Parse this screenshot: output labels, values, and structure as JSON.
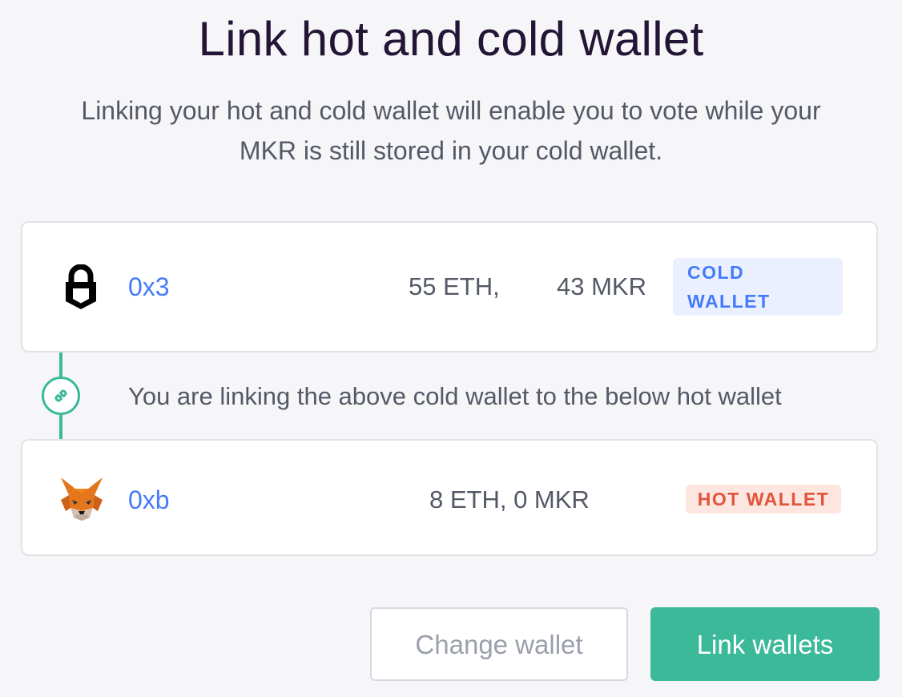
{
  "header": {
    "title": "Link hot and cold wallet",
    "subtitle_line1": "Linking your hot and cold wallet will enable you to vote while your",
    "subtitle_line2": "MKR is still stored in your cold wallet."
  },
  "cold_wallet": {
    "icon": "lock-icon",
    "address": "0x3",
    "eth_balance": "55 ETH,",
    "mkr_balance": "43 MKR",
    "badge_line1": "COLD",
    "badge_line2": "WALLET"
  },
  "connector": {
    "icon": "link-icon",
    "text": "You are linking the above cold wallet to the below hot wallet"
  },
  "hot_wallet": {
    "icon": "metamask-fox-icon",
    "address": "0xb",
    "balance": "8 ETH, 0 MKR",
    "badge": "HOT WALLET"
  },
  "actions": {
    "change_label": "Change wallet",
    "link_label": "Link wallets"
  },
  "colors": {
    "accent_green": "#3cb998",
    "address_blue": "#447afb",
    "hot_red": "#e2543c"
  }
}
